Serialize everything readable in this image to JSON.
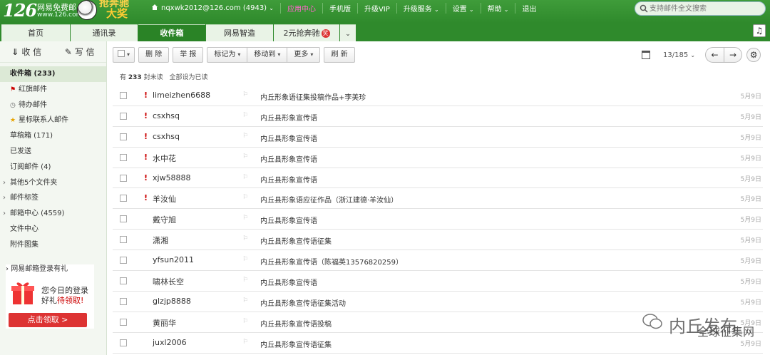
{
  "header": {
    "logo_number": "126",
    "logo_line1": "网易免费邮",
    "logo_line2": "www.126.com",
    "promo_line1": "抢奔驰",
    "promo_line2": "大奖",
    "account": "nqxwk2012@126.com (4943)",
    "nav": [
      "应用中心",
      "手机版",
      "升级VIP",
      "升级服务",
      "设置",
      "帮助",
      "退出"
    ],
    "search_placeholder": "支持邮件全文搜索"
  },
  "tabs": [
    {
      "label": "首页",
      "w": 0
    },
    {
      "label": "通讯录"
    },
    {
      "label": "收件箱"
    },
    {
      "label": "网易智造"
    },
    {
      "label": "2元抢奔驰",
      "badge": "奖"
    }
  ],
  "sidebar": {
    "receive": "收 信",
    "write": "写 信",
    "folders": [
      {
        "label": "收件箱 (233)"
      },
      {
        "label": "红旗邮件"
      },
      {
        "label": "待办邮件"
      },
      {
        "label": "星标联系人邮件"
      },
      {
        "label": "草稿箱 (171)"
      },
      {
        "label": "已发送"
      },
      {
        "label": "订阅邮件 (4)"
      },
      {
        "label": "其他5个文件夹"
      },
      {
        "label": "邮件标签"
      },
      {
        "label": "邮箱中心 (4559)"
      },
      {
        "label": "文件中心"
      },
      {
        "label": "附件图集"
      }
    ],
    "ad_title": "网易邮箱登录有礼",
    "ad_line1": "您今日的登录",
    "ad_line2a": "好礼",
    "ad_line2b": "待领取!",
    "ad_button": "点击领取 >"
  },
  "toolbar": {
    "delete": "删 除",
    "report": "举 报",
    "mark": "标记为",
    "move": "移动到",
    "more": "更多",
    "refresh": "刷 新"
  },
  "pager": {
    "text": "13/185"
  },
  "summary": {
    "count": "233",
    "unread_prefix": "有",
    "unread_suffix": "封未读",
    "mark_all": "全部设为已读"
  },
  "emails": [
    {
      "imp": "!",
      "from": "limeizhen6688",
      "subject": "内丘形象语征集投稿作品+李美珍",
      "date": "5月9日"
    },
    {
      "imp": "!",
      "from": "csxhsq",
      "subject": "内丘县形象宣传语",
      "date": "5月9日"
    },
    {
      "imp": "!",
      "from": "csxhsq",
      "subject": "内丘县形象宣传语",
      "date": "5月9日"
    },
    {
      "imp": "!",
      "from": "水中花",
      "subject": "内丘县形象宣传语",
      "date": "5月9日"
    },
    {
      "imp": "!",
      "from": "xjw58888",
      "subject": "内丘县形象宣传语",
      "date": "5月9日"
    },
    {
      "imp": "!",
      "from": "羊汝仙",
      "subject": "内丘县形象语应征作品（浙江建德·羊汝仙）",
      "date": "5月9日"
    },
    {
      "imp": "",
      "from": "戴守旭",
      "subject": "内丘县形象宣传语",
      "date": "5月9日"
    },
    {
      "imp": "",
      "from": "潇湘",
      "subject": "内丘县形象宣传语征集",
      "date": "5月9日"
    },
    {
      "imp": "",
      "from": "yfsun2011",
      "subject": "内丘县形象宣传语（陈福英13576820259）",
      "date": "5月9日"
    },
    {
      "imp": "",
      "from": "啸林长空",
      "subject": "内丘县形象宣传语",
      "date": "5月9日"
    },
    {
      "imp": "",
      "from": "glzjp8888",
      "subject": "内丘县形象宣传语征集活动",
      "date": "5月9日"
    },
    {
      "imp": "",
      "from": "黄丽华",
      "subject": "内丘县形象宣传语投稿",
      "date": "5月9日"
    },
    {
      "imp": "",
      "from": "juxl2006",
      "subject": "内丘县形象宣传语征集",
      "date": "5月9日"
    }
  ],
  "watermark": {
    "line1": "内丘发布",
    "line2": "全球征集网"
  }
}
